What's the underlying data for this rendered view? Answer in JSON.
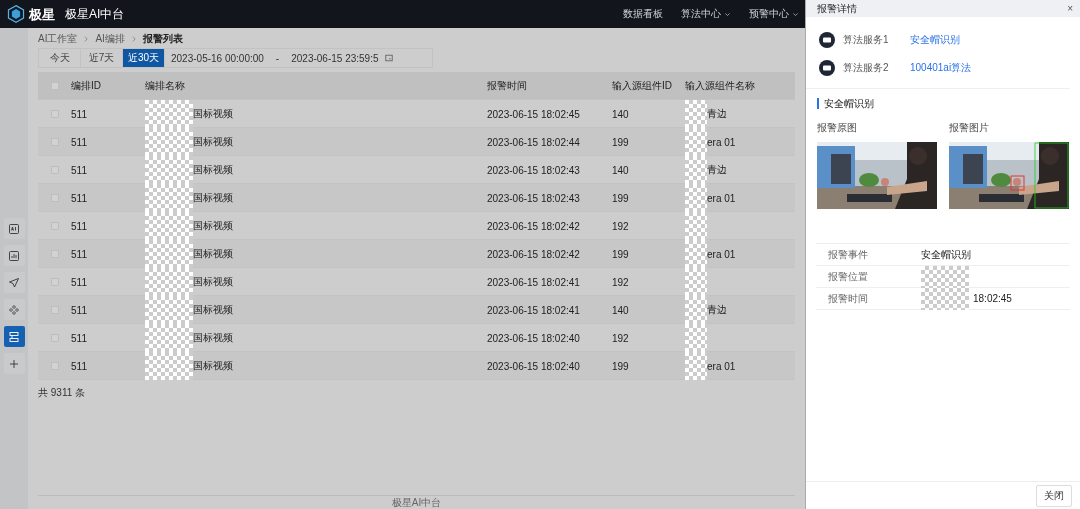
{
  "header": {
    "logo_text": "极星",
    "title": "极星AI中台",
    "nav": [
      {
        "label": "数据看板",
        "dropdown": false
      },
      {
        "label": "算法中心",
        "dropdown": true
      },
      {
        "label": "预警中心",
        "dropdown": true
      }
    ]
  },
  "sidebar": {
    "items": [
      {
        "kind": "ai",
        "selected": false
      },
      {
        "kind": "chart",
        "selected": false
      },
      {
        "kind": "send",
        "selected": false
      },
      {
        "kind": "nodes",
        "selected": false
      },
      {
        "kind": "flow",
        "selected": true
      },
      {
        "kind": "add",
        "selected": false
      }
    ]
  },
  "breadcrumb": [
    "AI工作室",
    "AI编排",
    "报警列表"
  ],
  "filters": {
    "ranges": [
      {
        "label": "今天",
        "selected": false
      },
      {
        "label": "近7天",
        "selected": false
      },
      {
        "label": "近30天",
        "selected": true
      }
    ],
    "start": "2023-05-16 00:00:00",
    "separator": "-",
    "end": "2023-06-15 23:59:5"
  },
  "table": {
    "all_checked": false,
    "columns": [
      "编排ID",
      "编排名称",
      "报警时间",
      "输入源组件ID",
      "输入源组件名称"
    ],
    "rows": [
      {
        "checked": false,
        "id": "511",
        "name": "国标视频",
        "time": "2023-06-15 18:02:45",
        "source_id": "140",
        "source_name": "青边"
      },
      {
        "checked": false,
        "id": "511",
        "name": "国标视频",
        "time": "2023-06-15 18:02:44",
        "source_id": "199",
        "source_name": "era 01"
      },
      {
        "checked": false,
        "id": "511",
        "name": "国标视频",
        "time": "2023-06-15 18:02:43",
        "source_id": "140",
        "source_name": "青边"
      },
      {
        "checked": false,
        "id": "511",
        "name": "国标视频",
        "time": "2023-06-15 18:02:43",
        "source_id": "199",
        "source_name": "era 01"
      },
      {
        "checked": false,
        "id": "511",
        "name": "国标视频",
        "time": "2023-06-15 18:02:42",
        "source_id": "192"
      },
      {
        "checked": false,
        "id": "511",
        "name": "国标视频",
        "time": "2023-06-15 18:02:42",
        "source_id": "199",
        "source_name": "era 01"
      },
      {
        "checked": false,
        "id": "511",
        "name": "国标视频",
        "time": "2023-06-15 18:02:41",
        "source_id": "192"
      },
      {
        "checked": false,
        "id": "511",
        "name": "国标视频",
        "time": "2023-06-15 18:02:41",
        "source_id": "140",
        "source_name": "青边"
      },
      {
        "checked": false,
        "id": "511",
        "name": "国标视频",
        "time": "2023-06-15 18:02:40",
        "source_id": "192"
      },
      {
        "checked": false,
        "id": "511",
        "name": "国标视频",
        "time": "2023-06-15 18:02:40",
        "source_id": "199",
        "source_name": "era 01"
      }
    ],
    "total": "共 9311 条"
  },
  "footer": "极星AI中台",
  "drawer": {
    "title": "报警详情",
    "close": "×",
    "services": [
      {
        "label": "算法服务1",
        "value": "安全帽识别"
      },
      {
        "label": "算法服务2",
        "value": "100401ai算法"
      }
    ],
    "section": "安全帽识别",
    "images": [
      {
        "label": "报警原图",
        "kind": "picture",
        "boxes": false
      },
      {
        "label": "报警图片",
        "kind": "picture",
        "boxes": true
      }
    ],
    "details": [
      {
        "label": "报警事件",
        "value": "安全帽识别",
        "redacted": false
      },
      {
        "label": "报警位置",
        "redacted": true
      },
      {
        "label": "报警时间",
        "value": "18:02:45",
        "redacted": true
      }
    ],
    "button": "关闭"
  }
}
